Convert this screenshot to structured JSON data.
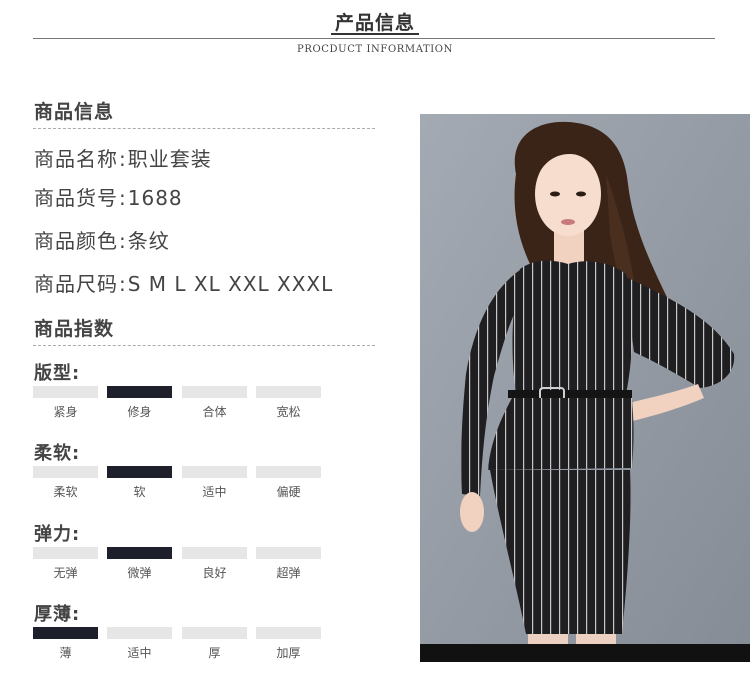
{
  "header": {
    "title": "产品信息",
    "subtitle": "PROCDUCT INFORMATION"
  },
  "product_info": {
    "section_title": "商品信息",
    "rows": [
      {
        "label": "商品名称",
        "sep": ":",
        "value": "职业套装"
      },
      {
        "label": "商品货号",
        "sep": ":",
        "value": "1688"
      },
      {
        "label": "商品颜色",
        "sep": ":",
        "value": "条纹"
      },
      {
        "label": "商品尺码",
        "sep": ":",
        "value": "S M L XL XXL XXXL"
      }
    ]
  },
  "product_index": {
    "section_title": "商品指数",
    "attributes": [
      {
        "title": "版型:",
        "options": [
          "紧身",
          "修身",
          "合体",
          "宽松"
        ],
        "selected_index": 1
      },
      {
        "title": "柔软:",
        "options": [
          "柔软",
          "软",
          "适中",
          "偏硬"
        ],
        "selected_index": 1
      },
      {
        "title": "弹力:",
        "options": [
          "无弹",
          "微弹",
          "良好",
          "超弹"
        ],
        "selected_index": 1
      },
      {
        "title": "厚薄:",
        "options": [
          "薄",
          "适中",
          "厚",
          "加厚"
        ],
        "selected_index": 0
      }
    ]
  },
  "colors": {
    "active_bar": "#1d1f2a",
    "inactive_bar": "#e6e6e6",
    "photo_background": "#8e949d",
    "dress": "#1f1f22",
    "stripe": "#c8c8c8"
  }
}
